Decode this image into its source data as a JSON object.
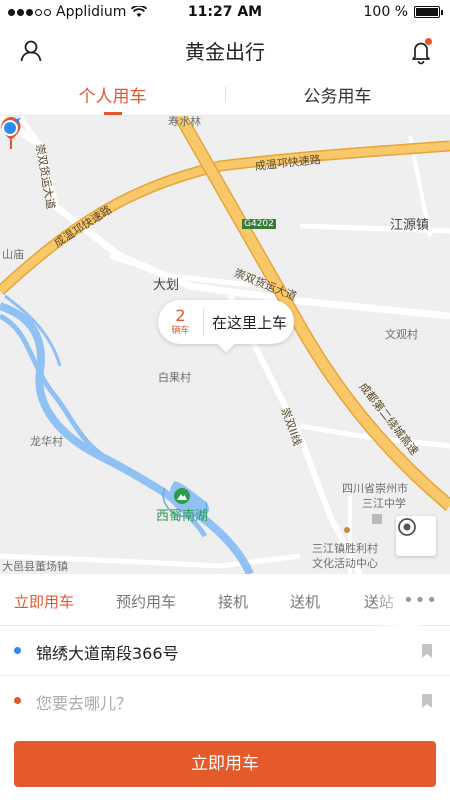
{
  "status_bar": {
    "carrier": "Applidium",
    "time": "11:27 AM",
    "battery": "100 %",
    "battery_level": 1.0
  },
  "header": {
    "title": "黄金出行",
    "user_icon": "user-icon",
    "bell_icon": "bell-icon",
    "has_notification": true
  },
  "mode_tabs": [
    {
      "label": "个人用车",
      "active": true
    },
    {
      "label": "公务用车",
      "active": false
    }
  ],
  "map": {
    "labels": {
      "chongshuang_huoyun_1": "崇双货运大道",
      "chengwen_ring_1": "成温邛快速路",
      "chengwen_ring_2": "成温邛快速路",
      "g4202": "G4202",
      "jiangyuan": "江源镇",
      "dahua": "大划",
      "chongshuang_huoyun_2": "崇双货运大道",
      "wenguan": "文观村",
      "baiguo": "白果村",
      "chongshuang_line": "崇双II线",
      "chengdu_expressway": "成都第二绕城高速",
      "longhua": "龙华村",
      "xishu_lake": "西蜀南湖",
      "sanjiang_school_1": "四川省崇州市",
      "sanjiang_school_2": "三江中学",
      "shengli_1": "三江镇胜利村",
      "shengli_2": "文化活动中心",
      "dongchang": "大邑县董场镇",
      "shan_miao": "山庙"
    },
    "callout": {
      "count": "2",
      "unit": "辆车",
      "text": "在这里上车"
    },
    "pin_icon": "location-pin-icon",
    "me_icon": "current-position-icon",
    "locate_icon": "locate-icon"
  },
  "service_tabs": [
    {
      "label": "立即用车",
      "active": true
    },
    {
      "label": "预约用车",
      "active": false
    },
    {
      "label": "接机",
      "active": false
    },
    {
      "label": "送机",
      "active": false
    },
    {
      "label": "送站",
      "active": false
    }
  ],
  "more_label": "•••",
  "addresses": {
    "from": {
      "value": "锦绣大道南段366号",
      "dot_color": "#2a8cf5"
    },
    "to": {
      "placeholder": "您要去哪儿？",
      "dot_color": "#e4572e"
    }
  },
  "cta_label": "立即用车",
  "colors": {
    "accent": "#e4572e",
    "road": "#f5b94a",
    "water": "#8fc1f5"
  }
}
